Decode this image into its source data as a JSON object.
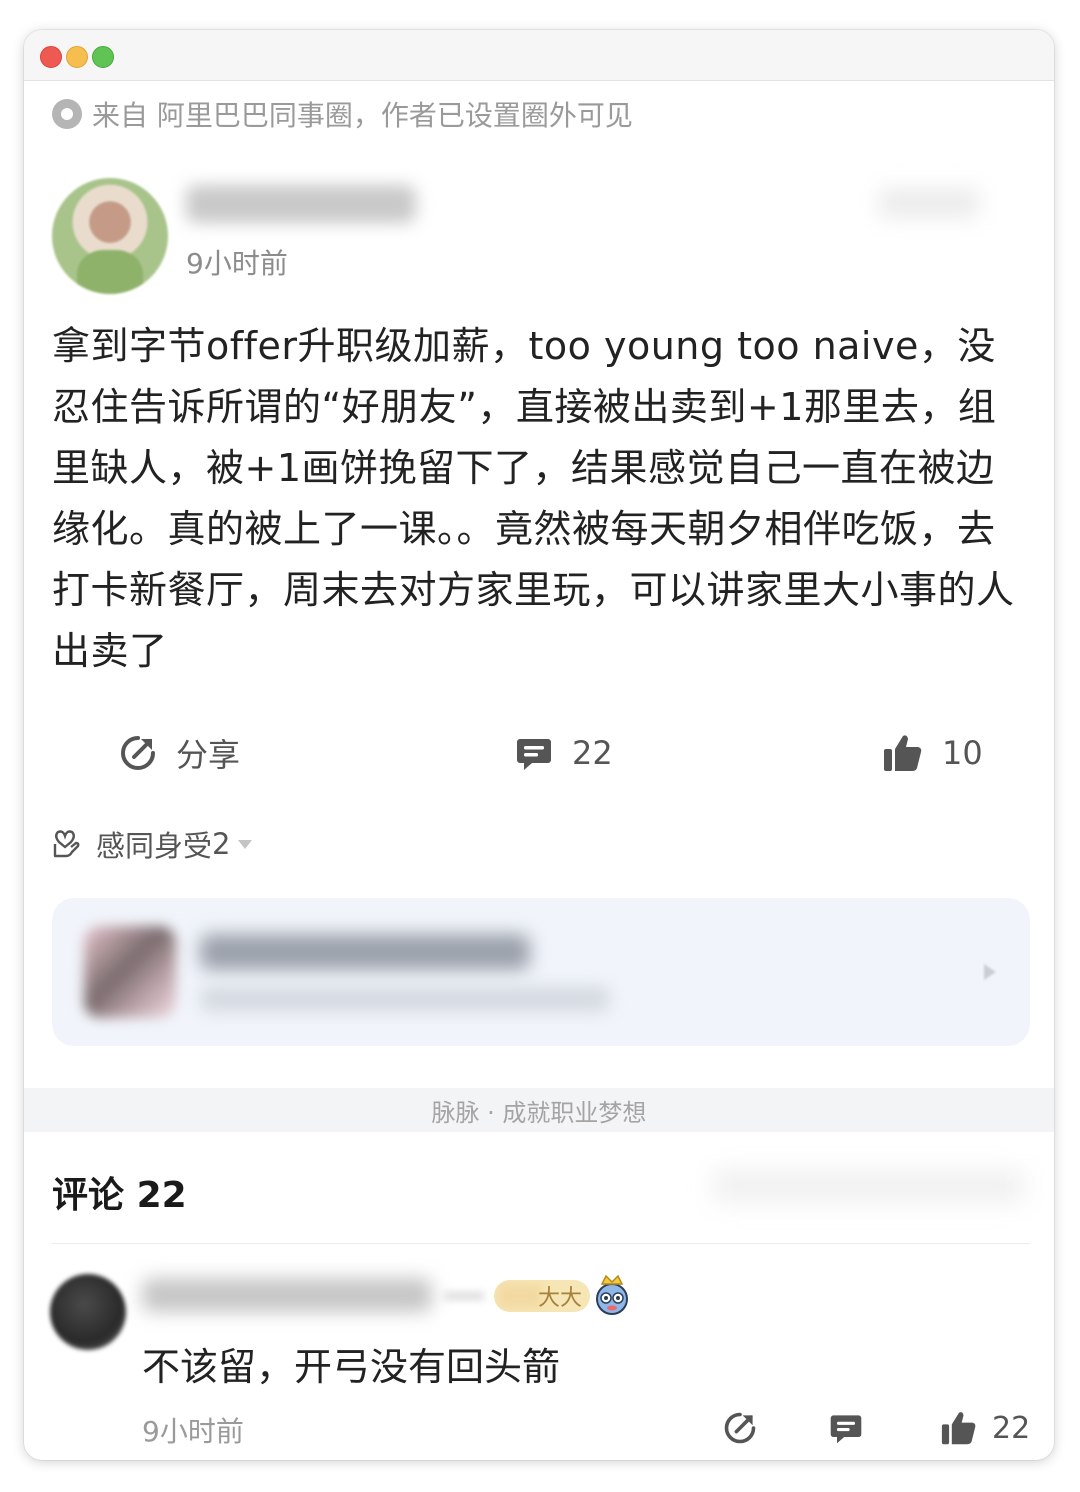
{
  "source": {
    "icon": "circle-target-icon",
    "text": "来自 阿里巴巴同事圈，作者已设置圈外可见"
  },
  "post": {
    "time": "9小时前",
    "content": "拿到字节offer升职级加薪，too young too naive，没忍住告诉所谓的“好朋友”，直接被出卖到+1那里去，组里缺人，被+1画饼挽留下了，结果感觉自己一直在被边缘化。真的被上了一课。。竟然被每天朝夕相伴吃饭，去打卡新餐厅，周末去对方家里玩，可以讲家里大小事的人出卖了"
  },
  "actions": {
    "share_label": "分享",
    "comment_count": "22",
    "like_count": "10"
  },
  "reaction": {
    "label": "感同身受",
    "count": "2"
  },
  "footer": {
    "slogan": "脉脉 · 成就职业梦想"
  },
  "comments": {
    "header_label": "评论",
    "header_count": "22",
    "items": [
      {
        "badge_text": "大大",
        "text": "不该留，开弓没有回头箭",
        "time": "9小时前",
        "like_count": "22"
      }
    ]
  },
  "colors": {
    "text_primary": "#222222",
    "text_secondary": "#9a9a9a",
    "icon_gray": "#555555",
    "card_bg": "#f1f5fb",
    "badge_bg": "#f7e6b5"
  }
}
